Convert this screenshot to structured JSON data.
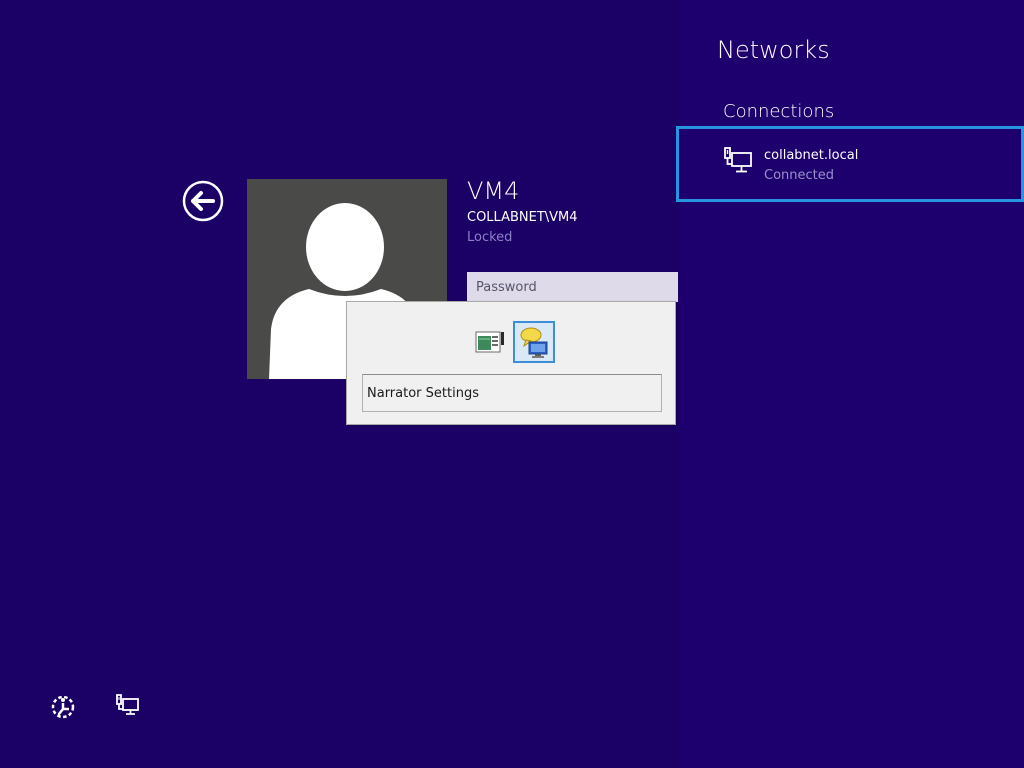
{
  "user": {
    "name": "VM4",
    "domain": "COLLABNET\\VM4",
    "status": "Locked"
  },
  "password": {
    "placeholder": "Password",
    "value": ""
  },
  "narrator_popup": {
    "label": "Narrator Settings",
    "icons": [
      "switch-list-icon",
      "narrator-icon"
    ]
  },
  "networks": {
    "title": "Networks",
    "connections_heading": "Connections",
    "items": [
      {
        "name": "collabnet.local",
        "status": "Connected",
        "icon": "wired-network-icon"
      }
    ]
  },
  "icons": {
    "back": "back-arrow-icon",
    "ease_of_access": "ease-of-access-icon",
    "network": "network-icon"
  },
  "colors": {
    "background": "#1b0065",
    "accent": "#2794e0",
    "avatar_bg": "#4a4a48"
  }
}
